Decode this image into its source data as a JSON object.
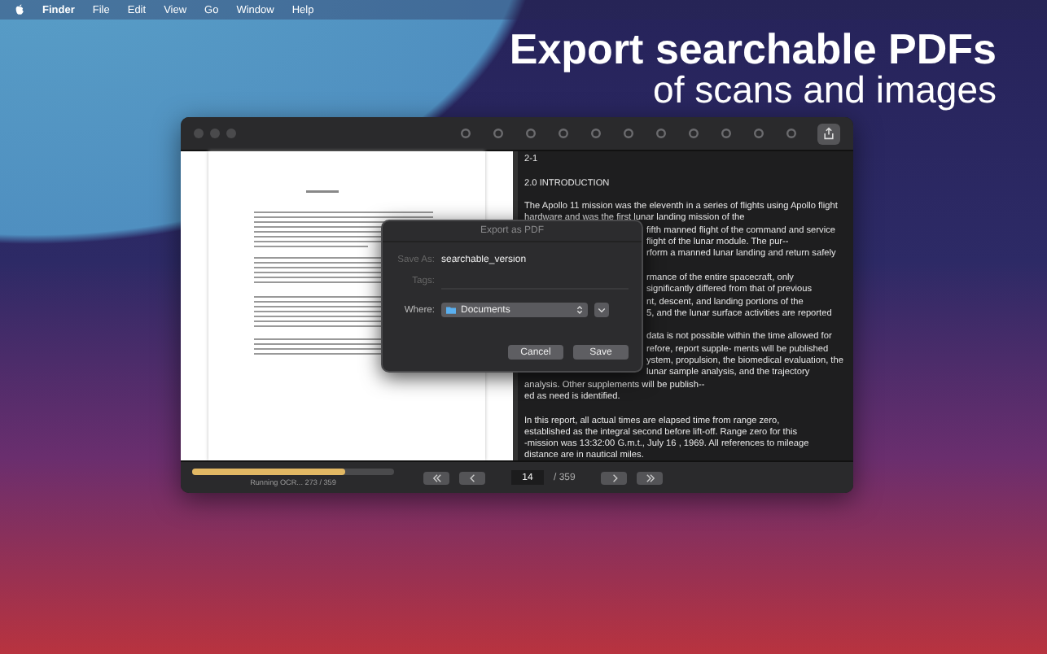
{
  "menu_bar": {
    "app": "Finder",
    "items": [
      "File",
      "Edit",
      "View",
      "Go",
      "Window",
      "Help"
    ]
  },
  "headline": {
    "title": "Export searchable PDFs",
    "subtitle": "of scans and images"
  },
  "text_pane": {
    "lines": [
      {
        "kind": "full",
        "text": "2-1"
      },
      {
        "kind": "blank"
      },
      {
        "kind": "full",
        "text": "2.0 INTRODUCTION"
      },
      {
        "kind": "blank"
      },
      {
        "kind": "full",
        "text": "The Apollo 11 mission was the eleventh in a series of flights using Apollo flight"
      },
      {
        "kind": "full",
        "text": "hardware and was the first lunar landing mission of the"
      },
      {
        "kind": "cut",
        "text": "fifth manned flight of the command and service"
      },
      {
        "kind": "cut",
        "text": "flight of the lunar module. The pur--"
      },
      {
        "kind": "cut",
        "text": "rform a manned lunar landing and return safely"
      },
      {
        "kind": "blank"
      },
      {
        "kind": "cut",
        "text": "rmance of the entire spacecraft, only"
      },
      {
        "kind": "cut",
        "text": "significantly differed from that of previous"
      },
      {
        "kind": "cut",
        "text": "nt, descent, and landing portions of the"
      },
      {
        "kind": "cut",
        "text": "5, and the lunar surface activities are reported"
      },
      {
        "kind": "blank"
      },
      {
        "kind": "cut",
        "text": "data is not possible within the time allowed for"
      },
      {
        "kind": "cut",
        "text": "refore, report supple- ments will be published"
      },
      {
        "kind": "cut",
        "text": "ystem, propulsion, the biomedical evaluation, the"
      },
      {
        "kind": "cut",
        "text": "lunar sample analysis, and the trajectory"
      },
      {
        "kind": "full",
        "text": "analysis. Other supplements will be publish--"
      },
      {
        "kind": "full",
        "text": "ed as need is identified."
      },
      {
        "kind": "blank"
      },
      {
        "kind": "full",
        "text": "In this report, all actual times are elapsed time from range zero,"
      },
      {
        "kind": "full",
        "text": "established as the integral second before lift-off. Range zero for this"
      },
      {
        "kind": "full",
        "text": "-mission was 13:32:00 G.m.t., July 16 , 1969. All references to mileage"
      },
      {
        "kind": "full",
        "text": "distance are in nautical miles."
      }
    ]
  },
  "dialog": {
    "title": "Export as PDF",
    "save_as_label": "Save As:",
    "save_as_value": "searchable_version",
    "tags_label": "Tags:",
    "where_label": "Where:",
    "where_value": "Documents",
    "buttons": [
      "Cancel",
      "Save"
    ]
  },
  "bottom_bar": {
    "progress": {
      "level": 0.76,
      "status": "Running OCR... 273 / 359"
    },
    "page": "14",
    "page_total": "/ 359"
  }
}
